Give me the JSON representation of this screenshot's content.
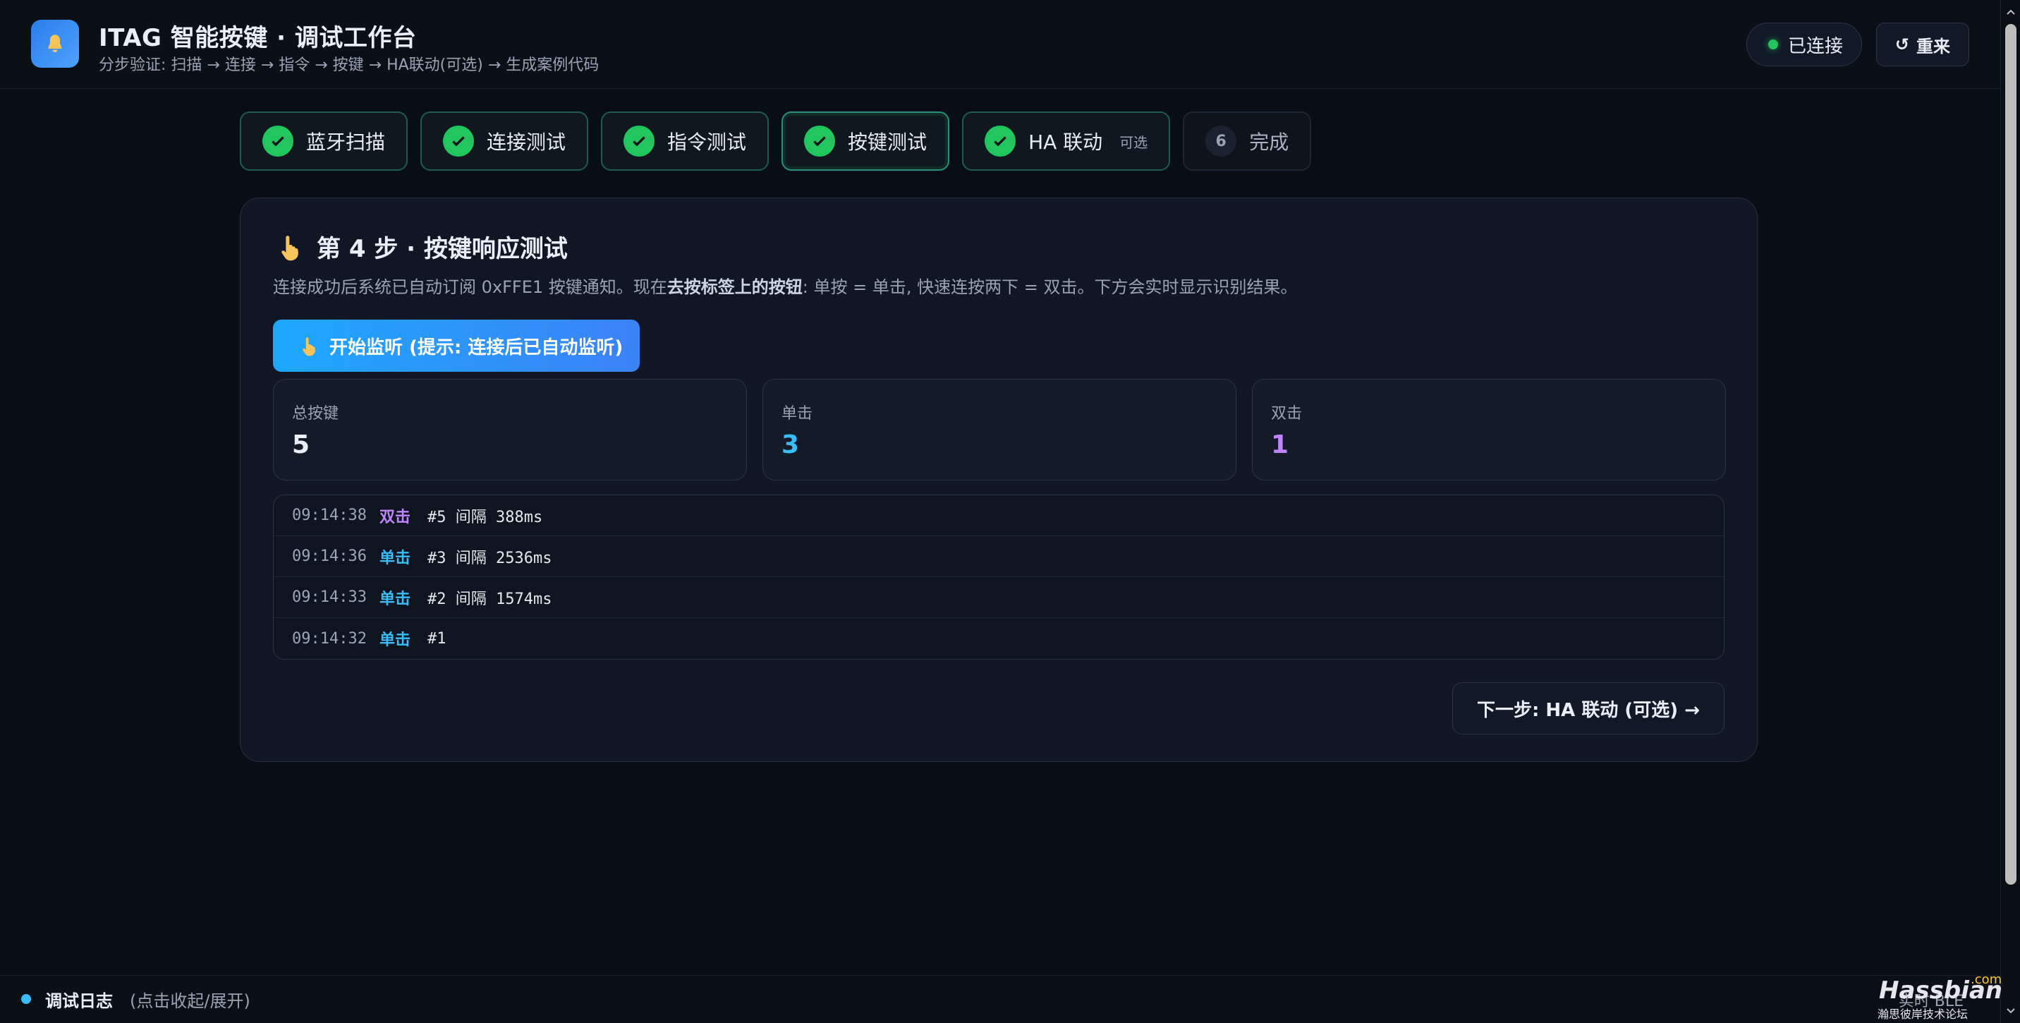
{
  "header": {
    "title": "ITAG 智能按键 · 调试工作台",
    "subtitle": "分步验证: 扫描 → 连接 → 指令 → 按键 → HA联动(可选) → 生成案例代码",
    "status": "已连接",
    "reset_label": "重来",
    "reset_prefix": "↺"
  },
  "steps": [
    {
      "label": "蓝牙扫描",
      "state": "done"
    },
    {
      "label": "连接测试",
      "state": "done"
    },
    {
      "label": "指令测试",
      "state": "done"
    },
    {
      "label": "按键测试",
      "state": "active"
    },
    {
      "label": "HA 联动",
      "tag": "可选",
      "state": "done"
    },
    {
      "label": "完成",
      "num": "6",
      "state": "pending"
    }
  ],
  "card": {
    "title": "第 4 步 · 按键响应测试",
    "desc_part1": "连接成功后系统已自动订阅 0xFFE1 按键通知。现在",
    "desc_bold": "去按标签上的按钮",
    "desc_part2": ": 单按 = 单击, 快速连按两下 = 双击。下方会实时显示识别结果。",
    "start_button": "开始监听 (提示: 连接后已自动监听)",
    "stats": [
      {
        "label": "总按键",
        "value": "5"
      },
      {
        "label": "单击",
        "value": "3"
      },
      {
        "label": "双击",
        "value": "1"
      }
    ],
    "log": [
      {
        "time": "09:14:38",
        "type": "双击",
        "detail": "#5 间隔 388ms"
      },
      {
        "time": "09:14:36",
        "type": "单击",
        "detail": "#3 间隔 2536ms"
      },
      {
        "time": "09:14:33",
        "type": "单击",
        "detail": "#2 间隔 1574ms"
      },
      {
        "time": "09:14:32",
        "type": "单击",
        "detail": "#1"
      }
    ],
    "next_label": "下一步: HA 联动 (可选) →"
  },
  "footer": {
    "title": "调试日志",
    "hint": "(点击收起/展开)",
    "right": "实时 BLE"
  },
  "watermark": {
    "brand": "Hassbian",
    "com": ".com",
    "slogan": "瀚思彼岸技术论坛"
  }
}
